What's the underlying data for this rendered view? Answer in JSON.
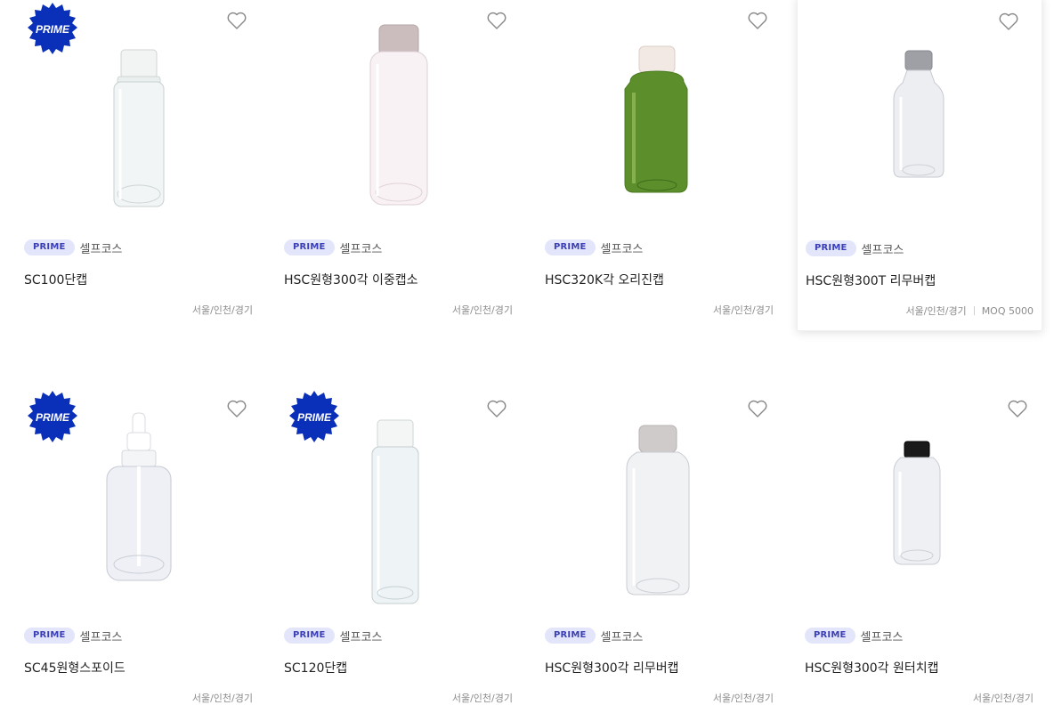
{
  "products": [
    {
      "badge": "PRIME",
      "prime_burst": true,
      "burst_text": "PRIME",
      "brand": "셀프코스",
      "name": "SC100단캡",
      "region": "서울/인천/경기",
      "moq": ""
    },
    {
      "badge": "PRIME",
      "prime_burst": false,
      "burst_text": "",
      "brand": "셀프코스",
      "name": "HSC원형300각 이중캡소",
      "region": "서울/인천/경기",
      "moq": ""
    },
    {
      "badge": "PRIME",
      "prime_burst": false,
      "burst_text": "",
      "brand": "셀프코스",
      "name": "HSC320K각 오리진캡",
      "region": "서울/인천/경기",
      "moq": ""
    },
    {
      "badge": "PRIME",
      "prime_burst": false,
      "burst_text": "",
      "brand": "셀프코스",
      "name": "HSC원형300T 리무버캡",
      "region": "서울/인천/경기",
      "moq": "MOQ 5000"
    },
    {
      "badge": "PRIME",
      "prime_burst": true,
      "burst_text": "PRIME",
      "brand": "셀프코스",
      "name": "SC45원형스포이드",
      "region": "서울/인천/경기",
      "moq": ""
    },
    {
      "badge": "PRIME",
      "prime_burst": true,
      "burst_text": "PRIME",
      "brand": "셀프코스",
      "name": "SC120단캡",
      "region": "서울/인천/경기",
      "moq": ""
    },
    {
      "badge": "PRIME",
      "prime_burst": false,
      "burst_text": "",
      "brand": "셀프코스",
      "name": "HSC원형300각 리무버캡",
      "region": "서울/인천/경기",
      "moq": ""
    },
    {
      "badge": "PRIME",
      "prime_burst": false,
      "burst_text": "",
      "brand": "셀프코스",
      "name": "HSC원형300각 원터치캡",
      "region": "서울/인천/경기",
      "moq": ""
    }
  ],
  "icons": {
    "favorite": "heart-outline-icon",
    "burst": "prime-starburst-badge"
  },
  "colors": {
    "prime_burst": "#0a2fb8",
    "prime_tag_bg": "#e3e5fb",
    "prime_tag_text": "#3b3fb6",
    "heart_stroke": "#888888"
  }
}
